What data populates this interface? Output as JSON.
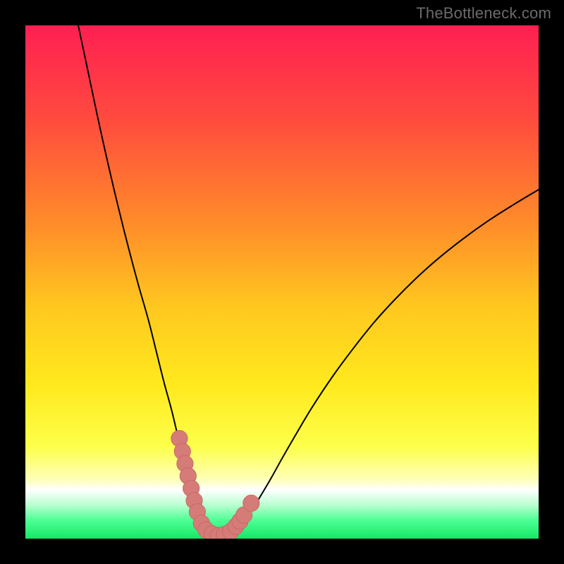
{
  "watermark": {
    "text": "TheBottleneck.com"
  },
  "colors": {
    "black": "#000000",
    "curve": "#000000",
    "marker_fill": "#d57b78",
    "marker_stroke": "#c76764",
    "gradient_stops": [
      {
        "offset": 0.0,
        "color": "#ff1f52"
      },
      {
        "offset": 0.18,
        "color": "#ff4a3e"
      },
      {
        "offset": 0.38,
        "color": "#ff8a2a"
      },
      {
        "offset": 0.55,
        "color": "#ffc81f"
      },
      {
        "offset": 0.7,
        "color": "#ffe91e"
      },
      {
        "offset": 0.82,
        "color": "#fdff4a"
      },
      {
        "offset": 0.885,
        "color": "#feffb8"
      },
      {
        "offset": 0.905,
        "color": "#ffffff"
      },
      {
        "offset": 0.935,
        "color": "#b8ffcf"
      },
      {
        "offset": 0.965,
        "color": "#4bff93"
      },
      {
        "offset": 1.0,
        "color": "#17e768"
      }
    ]
  },
  "chart_data": {
    "type": "line",
    "title": "",
    "xlabel": "",
    "ylabel": "",
    "xlim": [
      0,
      100
    ],
    "ylim": [
      0,
      100
    ],
    "legend": false,
    "grid": false,
    "series": [
      {
        "name": "bottleneck-curve",
        "x": [
          10.3,
          12,
          14,
          16,
          18,
          20,
          22,
          24,
          25.5,
          27,
          28.5,
          29.7,
          30.8,
          31.8,
          32.6,
          33.4,
          34.2,
          35.0,
          36.0,
          37.0,
          38.0,
          39.2,
          40.5,
          42,
          44,
          46,
          48,
          50,
          53,
          56,
          60,
          64,
          68,
          72,
          76,
          80,
          85,
          90,
          95,
          100
        ],
        "y": [
          100,
          92,
          82.5,
          73.5,
          65,
          57,
          49.5,
          42.5,
          36.5,
          30.5,
          25,
          20,
          15.5,
          11.5,
          8.0,
          5.2,
          3.0,
          1.6,
          0.7,
          0.2,
          0.2,
          0.5,
          1.3,
          2.8,
          5.4,
          8.6,
          12.0,
          15.6,
          20.8,
          25.8,
          31.8,
          37.2,
          42.2,
          46.6,
          50.6,
          54.2,
          58.2,
          61.8,
          65.0,
          68.0
        ]
      }
    ],
    "markers": [
      {
        "name": "left-cluster-1",
        "x": 30.0,
        "y": 19.5,
        "r": 1.6
      },
      {
        "name": "left-cluster-2",
        "x": 30.6,
        "y": 17.0,
        "r": 1.6
      },
      {
        "name": "left-cluster-3",
        "x": 31.1,
        "y": 14.6,
        "r": 1.6
      },
      {
        "name": "left-cluster-4",
        "x": 31.7,
        "y": 12.2,
        "r": 1.6
      },
      {
        "name": "left-cluster-5",
        "x": 32.3,
        "y": 9.8,
        "r": 1.6
      },
      {
        "name": "left-cluster-6",
        "x": 32.9,
        "y": 7.4,
        "r": 1.6
      },
      {
        "name": "left-cluster-7",
        "x": 33.5,
        "y": 5.2,
        "r": 1.6
      },
      {
        "name": "bottom-1",
        "x": 34.3,
        "y": 3.0,
        "r": 1.6
      },
      {
        "name": "bottom-2",
        "x": 35.2,
        "y": 1.7,
        "r": 1.6
      },
      {
        "name": "bottom-3",
        "x": 36.4,
        "y": 0.9,
        "r": 1.6
      },
      {
        "name": "bottom-4",
        "x": 37.6,
        "y": 0.6,
        "r": 1.6
      },
      {
        "name": "bottom-5",
        "x": 38.8,
        "y": 0.8,
        "r": 1.6
      },
      {
        "name": "bottom-6",
        "x": 40.0,
        "y": 1.4,
        "r": 1.6
      },
      {
        "name": "right-cluster-1",
        "x": 41.0,
        "y": 2.4,
        "r": 1.6
      },
      {
        "name": "right-cluster-2",
        "x": 41.8,
        "y": 3.4,
        "r": 1.6
      },
      {
        "name": "right-cluster-3",
        "x": 42.6,
        "y": 4.6,
        "r": 1.6
      },
      {
        "name": "right-outlier",
        "x": 44.0,
        "y": 6.9,
        "r": 1.6
      }
    ],
    "annotations": []
  }
}
